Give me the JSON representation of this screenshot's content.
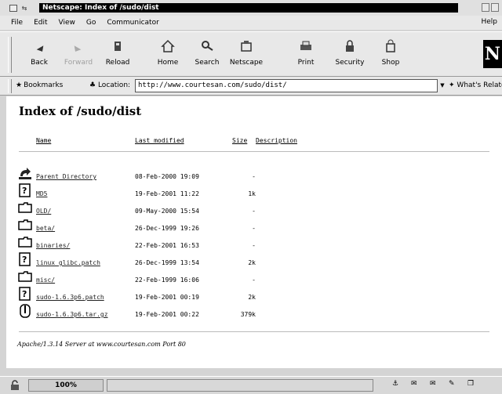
{
  "window": {
    "title": "Netscape: Index of /sudo/dist"
  },
  "menu": [
    "File",
    "Edit",
    "View",
    "Go",
    "Communicator"
  ],
  "menu_help": "Help",
  "toolbar": {
    "buttons": [
      {
        "label": "Back",
        "icon": "back-arrow-icon",
        "enabled": true
      },
      {
        "label": "Forward",
        "icon": "forward-arrow-icon",
        "enabled": false
      },
      {
        "label": "Reload",
        "icon": "reload-icon",
        "enabled": true
      },
      {
        "label": "Home",
        "icon": "home-icon",
        "enabled": true
      },
      {
        "label": "Search",
        "icon": "search-icon",
        "enabled": true
      },
      {
        "label": "Netscape",
        "icon": "netscape-icon",
        "enabled": true
      },
      {
        "label": "Print",
        "icon": "print-icon",
        "enabled": true
      },
      {
        "label": "Security",
        "icon": "security-icon",
        "enabled": true
      },
      {
        "label": "Shop",
        "icon": "shop-icon",
        "enabled": true
      }
    ],
    "logo": "N"
  },
  "location": {
    "bookmarks_label": "Bookmarks",
    "location_label": "Location:",
    "url": "http://www.courtesan.com/sudo/dist/",
    "related_label": "What's Related"
  },
  "page": {
    "heading": "Index of /sudo/dist",
    "columns": {
      "name": "Name",
      "modified": "Last modified",
      "size": "Size",
      "description": "Description"
    },
    "rows": [
      {
        "icon": "parent-dir-icon",
        "name": "Parent Directory",
        "modified": "08-Feb-2000 19:09",
        "size": "-"
      },
      {
        "icon": "text-file-icon",
        "name": "MD5",
        "modified": "19-Feb-2001 11:22",
        "size": "1k"
      },
      {
        "icon": "folder-icon",
        "name": "OLD/",
        "modified": "09-May-2000 15:54",
        "size": "-"
      },
      {
        "icon": "folder-icon",
        "name": "beta/",
        "modified": "26-Dec-1999 19:26",
        "size": "-"
      },
      {
        "icon": "folder-icon",
        "name": "binaries/",
        "modified": "22-Feb-2001 16:53",
        "size": "-"
      },
      {
        "icon": "text-file-icon",
        "name": "linux_glibc.patch",
        "modified": "26-Dec-1999 13:54",
        "size": "2k"
      },
      {
        "icon": "folder-icon",
        "name": "misc/",
        "modified": "22-Feb-1999 16:06",
        "size": "-"
      },
      {
        "icon": "text-file-icon",
        "name": "sudo-1.6.3p6.patch",
        "modified": "19-Feb-2001 00:19",
        "size": "2k"
      },
      {
        "icon": "compressed-file-icon",
        "name": "sudo-1.6.3p6.tar.gz",
        "modified": "19-Feb-2001 00:22",
        "size": "379k"
      }
    ],
    "address": "Apache/1.3.14 Server at www.courtesan.com Port 80"
  },
  "status": {
    "zoom": "100%"
  }
}
